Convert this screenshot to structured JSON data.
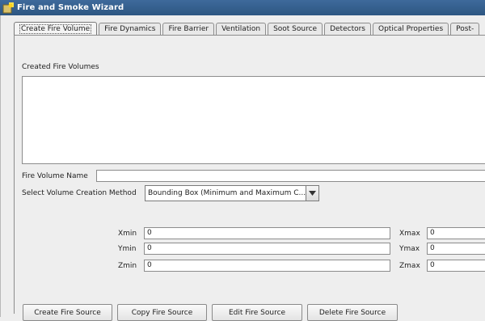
{
  "window": {
    "title": "Fire and Smoke Wizard"
  },
  "tabs": [
    {
      "label": "Create Fire Volume"
    },
    {
      "label": "Fire Dynamics"
    },
    {
      "label": "Fire Barrier"
    },
    {
      "label": "Ventilation"
    },
    {
      "label": "Soot Source"
    },
    {
      "label": "Detectors"
    },
    {
      "label": "Optical Properties"
    },
    {
      "label": "Post-"
    }
  ],
  "panel": {
    "list_label": "Created Fire Volumes",
    "name_label": "Fire Volume Name",
    "name_value": "",
    "method_label": "Select Volume Creation Method",
    "method_value": "Bounding Box (Minimum and Maximum C...",
    "fields": {
      "xmin_label": "Xmin",
      "xmin": "0",
      "ymin_label": "Ymin",
      "ymin": "0",
      "zmin_label": "Zmin",
      "zmin": "0",
      "xmax_label": "Xmax",
      "xmax": "0",
      "ymax_label": "Ymax",
      "ymax": "0",
      "zmax_label": "Zmax",
      "zmax": "0"
    }
  },
  "buttons": {
    "create": "Create Fire Source",
    "copy": "Copy Fire Source",
    "edit": "Edit Fire Source",
    "delete": "Delete Fire Source"
  },
  "icons": {
    "app": "fire-wizard-icon",
    "dropdown": "triangle-down-icon"
  },
  "colors": {
    "titlebar": "#2d5682",
    "panel": "#eeeeee",
    "border": "#8c8c8c"
  }
}
